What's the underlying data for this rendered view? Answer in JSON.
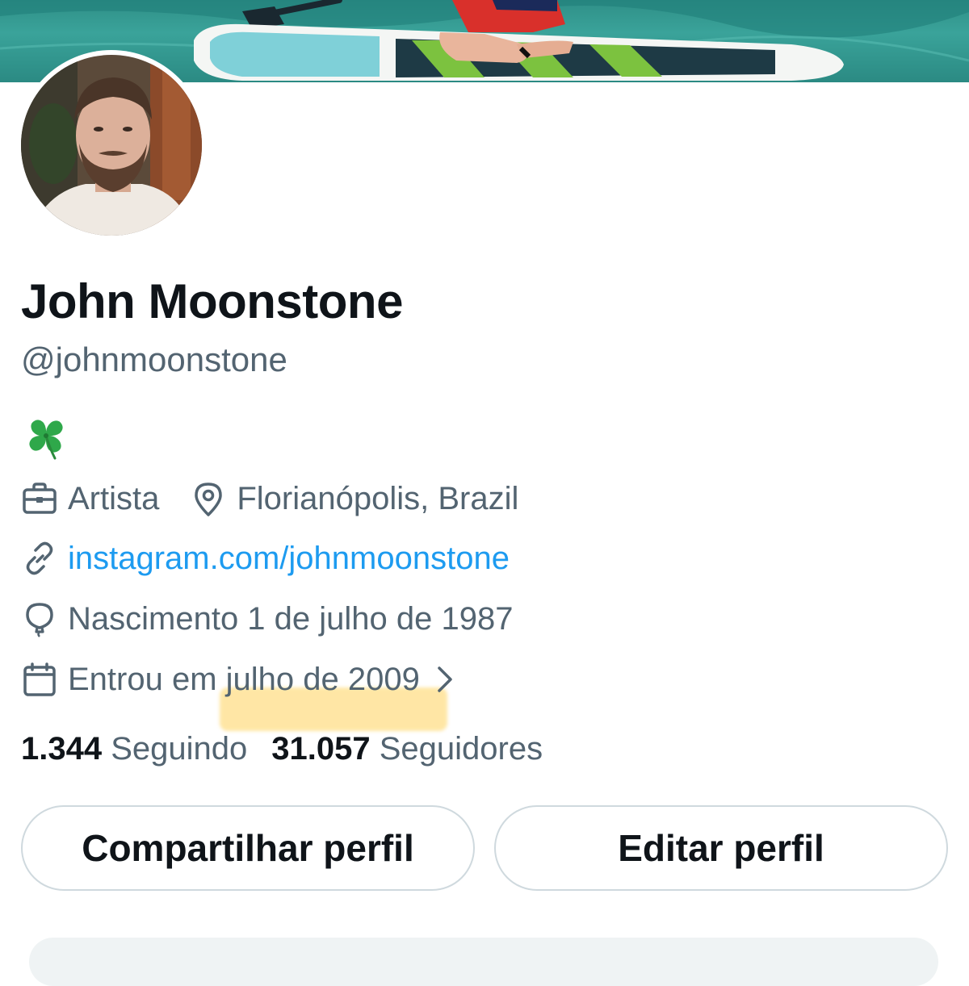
{
  "profile": {
    "name": "John Moonstone",
    "handle": "@johnmoonstone",
    "bio_emoji": "four-leaf-clover"
  },
  "details": {
    "profession": "Artista",
    "location": "Florianópolis, Brazil",
    "website": "instagram.com/johnmoonstone",
    "birthday": "Nascimento 1 de julho de 1987",
    "joined": "Entrou em julho de 2009"
  },
  "stats": {
    "following_count": "1.344",
    "following_label": "Seguindo",
    "followers_count": "31.057",
    "followers_label": "Seguidores"
  },
  "buttons": {
    "share_label": "Compartilhar perfil",
    "edit_label": "Editar perfil"
  },
  "icons": {
    "profession": "briefcase-icon",
    "location": "location-pin-icon",
    "website": "link-icon",
    "birthday": "balloon-icon",
    "joined": "calendar-icon",
    "joined_more": "chevron-right-icon"
  },
  "colors": {
    "link": "#1d9bf0",
    "secondary_text": "#536471",
    "primary_text": "#0f1419",
    "highlight": "#ffd35c"
  }
}
